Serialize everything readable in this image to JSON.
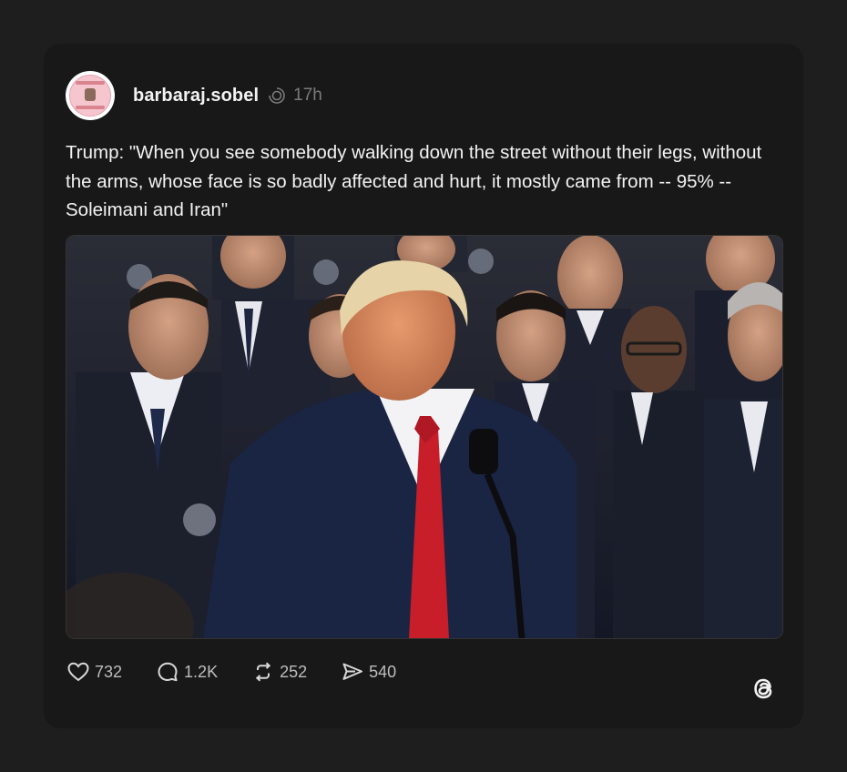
{
  "post": {
    "username": "barbaraj.sobel",
    "time": "17h",
    "text": "Trump: \"When you see somebody walking down the street without their legs, without the arms, whose face is so badly affected and hurt, it mostly came from -- 95% -- Soleimani and Iran\"",
    "image_alt": "Trump speaking at a podium in front of a group of men in dark suits"
  },
  "actions": {
    "likes": "732",
    "replies": "1.2K",
    "reposts": "252",
    "shares": "540"
  },
  "icons": {
    "like": "heart-icon",
    "reply": "comment-icon",
    "repost": "repost-icon",
    "share": "share-icon",
    "brand": "threads-logo-icon",
    "verified": "verified-icon"
  },
  "colors": {
    "background": "#1e1e1e",
    "card": "#181818",
    "tie": "#c81e2a"
  }
}
